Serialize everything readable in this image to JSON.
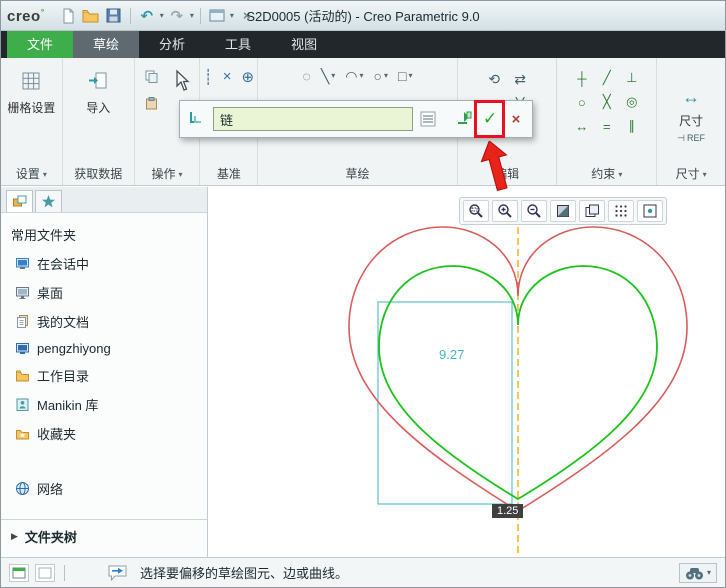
{
  "window": {
    "logo": "creo",
    "title": "S2D0005 (活动的) - Creo Parametric 9.0"
  },
  "tabs": [
    {
      "label": "文件"
    },
    {
      "label": "草绘"
    },
    {
      "label": "分析"
    },
    {
      "label": "工具"
    },
    {
      "label": "视图"
    }
  ],
  "ribbon": {
    "grid_settings": "栅格设置",
    "import_label": "导入",
    "labels": {
      "settings": "设置",
      "get_data": "获取数据",
      "operations": "操作",
      "datum": "基准",
      "sketch": "草绘",
      "edit": "编辑",
      "constrain": "约束",
      "dimension": "尺寸"
    },
    "dim_button": "尺寸",
    "dim_ref": "REF",
    "datum_tools": [
      "┊",
      "×",
      "⊕"
    ],
    "sketch_tools": [
      "◌",
      "╲",
      "◠",
      "○",
      "□"
    ],
    "edit_tools": [
      "⟲",
      "⇄",
      "≡",
      "╳"
    ],
    "constraint_tools": [
      "┼",
      "╱",
      "⊥",
      "○",
      "╳",
      "◎",
      "↔",
      "=",
      "∥"
    ]
  },
  "overlay": {
    "input_value": "链"
  },
  "sidebar": {
    "header": "常用文件夹",
    "items": [
      {
        "label": "在会话中"
      },
      {
        "label": "桌面"
      },
      {
        "label": "我的文档"
      },
      {
        "label": "pengzhiyong"
      },
      {
        "label": "工作目录"
      },
      {
        "label": "Manikin 库"
      },
      {
        "label": "收藏夹"
      },
      {
        "label": "网络"
      }
    ],
    "footer": "文件夹树"
  },
  "canvas": {
    "dim_height": "9.27",
    "dim_bottom": "1.25"
  },
  "statusbar": {
    "message": "选择要偏移的草绘图元、边或曲线。"
  },
  "icons": {
    "caret": "▾",
    "check": "✓",
    "close": "×",
    "undo": "↶",
    "redo": "↷",
    "expand": "▶",
    "dim": "↔",
    "ref_dim": "⊣"
  },
  "colors": {
    "tab_file_green": "#3dae49",
    "heart_outer": "#d85c5c",
    "heart_inner": "#1dc21d",
    "selection_box": "#66c6cb",
    "centerline": "#efa400",
    "dimension_text": "#3fb6c9",
    "highlight_red": "#e81123",
    "input_bg": "#e9f5d4"
  }
}
